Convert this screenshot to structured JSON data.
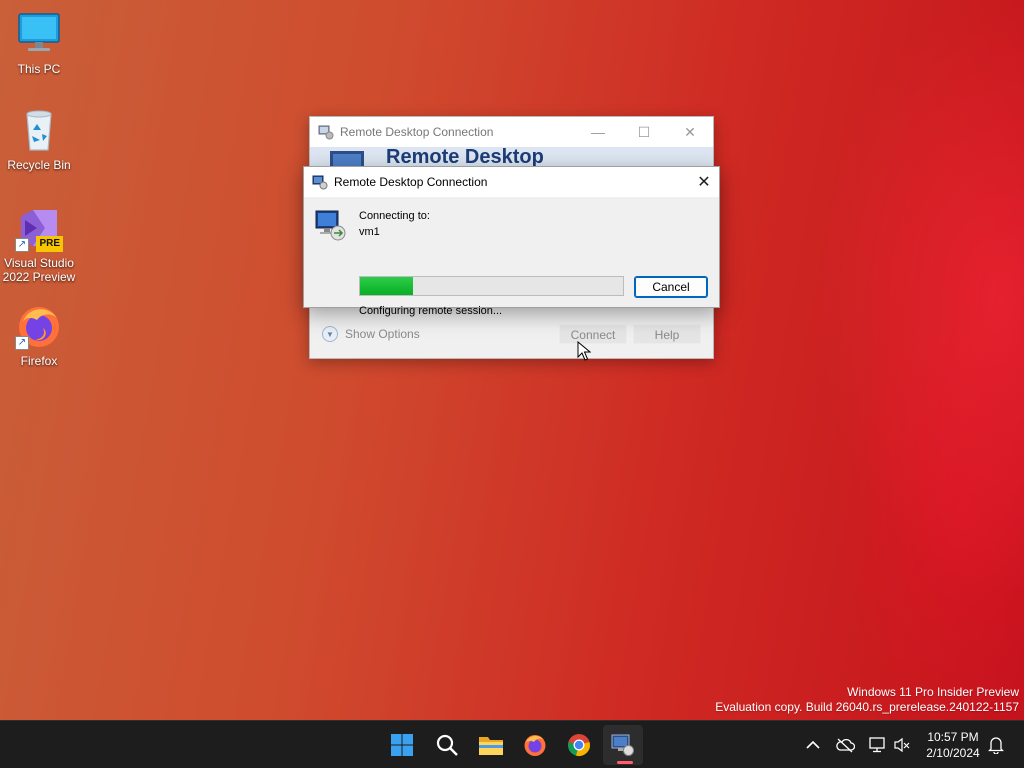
{
  "desktop": {
    "icons": [
      {
        "label": "This PC",
        "icon": "monitor-icon"
      },
      {
        "label": "Recycle Bin",
        "icon": "recycle-bin-icon"
      },
      {
        "label": "Visual Studio 2022 Preview",
        "icon": "visual-studio-preview-icon",
        "badge": "PRE"
      },
      {
        "label": "Firefox",
        "icon": "firefox-icon"
      }
    ]
  },
  "background_window": {
    "title": "Remote Desktop Connection",
    "banner_text": "Remote Desktop",
    "show_options_label": "Show Options",
    "connect_label": "Connect",
    "help_label": "Help",
    "minimize_glyph": "—",
    "maximize_glyph": "☐",
    "close_glyph": "✕"
  },
  "dialog": {
    "title": "Remote Desktop Connection",
    "close_glyph": "✕",
    "connecting_label": "Connecting to:",
    "host": "vm1",
    "progress_fraction": 0.2,
    "cancel_label": "Cancel",
    "status": "Configuring remote session..."
  },
  "watermark": {
    "line1": "Windows 11 Pro Insider Preview",
    "line2": "Evaluation copy. Build 26040.rs_prerelease.240122-1157"
  },
  "taskbar": {
    "apps": [
      "start-icon",
      "search-icon",
      "file-explorer-icon",
      "firefox-icon",
      "chrome-icon",
      "remote-desktop-icon"
    ],
    "active_app": "remote-desktop-icon",
    "tray": [
      "show-hidden-icons-chevron",
      "onedrive-icon",
      "network-icon",
      "volume-muted-icon",
      "notifications-bell-icon"
    ],
    "time": "10:57 PM",
    "date": "2/10/2024"
  },
  "colors": {
    "progress_fill": "#06b025",
    "accent": "#0067c0",
    "taskbar": "#1d1d1d"
  }
}
